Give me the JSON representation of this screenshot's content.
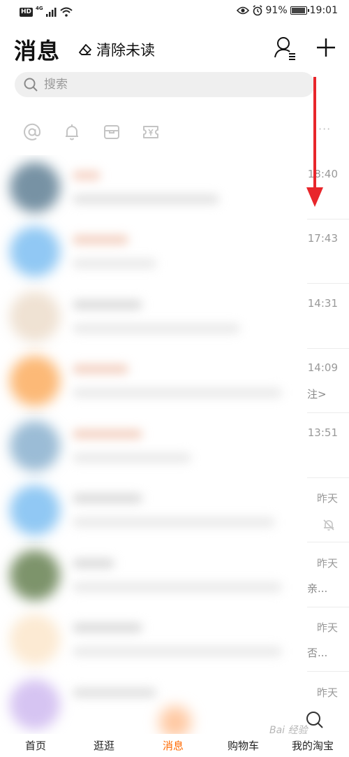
{
  "status_bar": {
    "hd": "HD",
    "net": "4G",
    "battery": "91%",
    "time": "19:01"
  },
  "header": {
    "title": "消息",
    "clear_unread": "清除未读"
  },
  "search": {
    "placeholder": "搜索"
  },
  "shortcuts": {
    "more": "···"
  },
  "conversations": [
    {
      "time": "18:40",
      "tail": ""
    },
    {
      "time": "17:43",
      "tail": ""
    },
    {
      "time": "14:31",
      "tail": ""
    },
    {
      "time": "14:09",
      "tail": "注>"
    },
    {
      "time": "13:51",
      "tail": ""
    },
    {
      "time": "昨天",
      "tail": ""
    },
    {
      "time": "昨天",
      "tail": "亲..."
    },
    {
      "time": "昨天",
      "tail": "否..."
    },
    {
      "time": "昨天",
      "tail": ""
    }
  ],
  "tabbar": {
    "home": "首页",
    "browse": "逛逛",
    "messages": "消息",
    "cart": "购物车",
    "mine": "我的淘宝"
  },
  "colors": {
    "accent": "#ff6a00",
    "arrow": "#e8262b"
  },
  "watermark": "Bai 经验"
}
